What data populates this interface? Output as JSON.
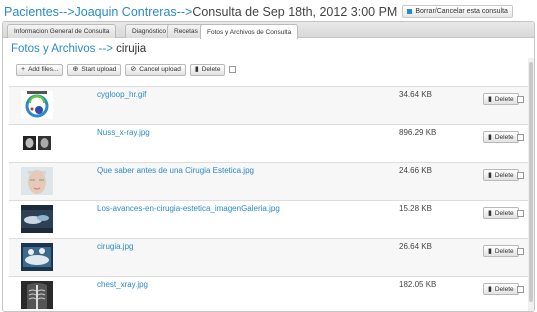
{
  "header": {
    "crumb_pacientes": "Pacientes",
    "crumb_sep": "-->",
    "crumb_patient": "Joaquin Contreras",
    "crumb_current": "Consulta de Sep 18th, 2012 3:00 PM",
    "delete_consult_label": "Borrar/Cancelar esta consulta"
  },
  "tabs": [
    {
      "label": "Informacion General de Consulta"
    },
    {
      "label": "Diagnóstico"
    },
    {
      "label": "Recetas"
    },
    {
      "label": "Fotos y Archivos de Consulta"
    }
  ],
  "section": {
    "title_blue": "Fotos y Archivos -->",
    "title_folder": "cirujia"
  },
  "toolbar": {
    "add_files": "Add files...",
    "start_upload": "Start upload",
    "cancel_upload": "Cancel upload",
    "delete": "Delete"
  },
  "files": [
    {
      "name": "cygloop_hr.gif",
      "size": "34.64 KB",
      "delete": "Delete"
    },
    {
      "name": "Nuss_x-ray.jpg",
      "size": "896.29 KB",
      "delete": "Delete"
    },
    {
      "name": "Que saber antes de una Cirugia Estetica.jpg",
      "size": "24.66 KB",
      "delete": "Delete"
    },
    {
      "name": "Los-avances-en-cirugia-estetica_imagenGaleria.jpg",
      "size": "15.28 KB",
      "delete": "Delete"
    },
    {
      "name": "cirugia.jpg",
      "size": "26.64 KB",
      "delete": "Delete"
    },
    {
      "name": "chest_xray.jpg",
      "size": "182.05 KB",
      "delete": "Delete"
    }
  ],
  "colors": {
    "link": "#2a8bc8",
    "border": "#c5c5c5",
    "row_alt": "#f7f7f7"
  }
}
